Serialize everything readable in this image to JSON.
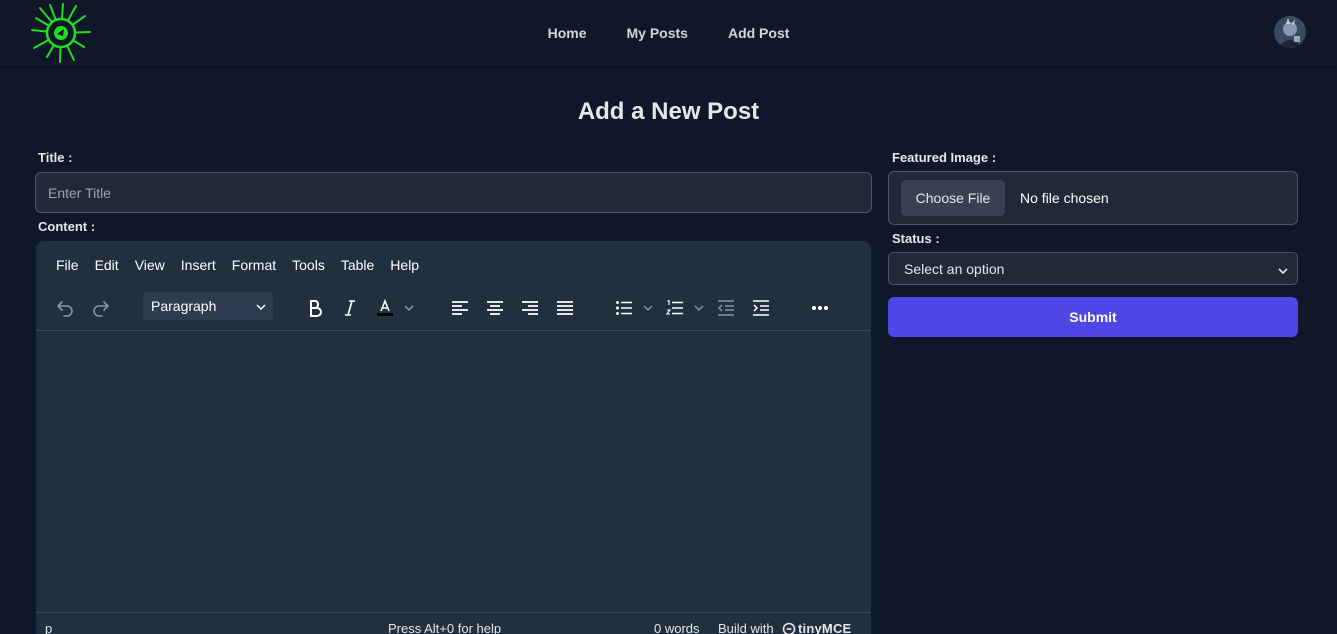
{
  "nav": {
    "links": [
      "Home",
      "My Posts",
      "Add Post"
    ],
    "logo_icon": "green-splat-logo-icon",
    "avatar_icon": "user-avatar"
  },
  "page": {
    "title": "Add a New Post"
  },
  "form": {
    "title_label": "Title :",
    "title_placeholder": "Enter Title",
    "title_value": "",
    "content_label": "Content :",
    "image_label": "Featured Image :",
    "file_button": "Choose File",
    "file_status": "No file chosen",
    "status_label": "Status :",
    "status_selected": "Select an option",
    "submit_label": "Submit"
  },
  "editor": {
    "menu": [
      "File",
      "Edit",
      "View",
      "Insert",
      "Format",
      "Tools",
      "Table",
      "Help"
    ],
    "block_format": "Paragraph",
    "toolbar_icons": [
      "undo-icon",
      "redo-icon",
      "bold-icon",
      "italic-icon",
      "text-color-icon",
      "align-left-icon",
      "align-center-icon",
      "align-right-icon",
      "align-justify-icon",
      "bullet-list-icon",
      "numbered-list-icon",
      "outdent-icon",
      "indent-icon",
      "more-icon"
    ],
    "status": {
      "path": "p",
      "help": "Press Alt+0 for help",
      "words": "0 words",
      "build": "Build with",
      "brand": "tinyMCE"
    }
  },
  "colors": {
    "background": "#0f172a",
    "navbar": "#0f1729",
    "accent": "#4f46e5",
    "editor": "#222f3e",
    "logo": "#22dd22"
  }
}
